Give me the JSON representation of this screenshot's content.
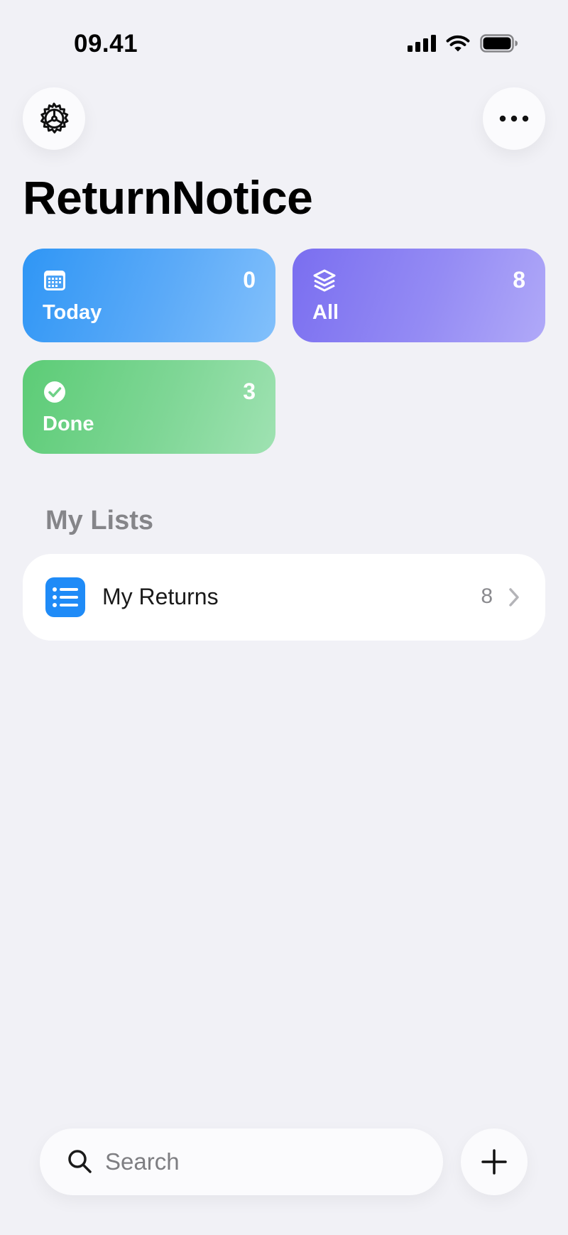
{
  "status_bar": {
    "time": "09.41",
    "icons": [
      "cellular-signal-icon",
      "wifi-icon",
      "battery-icon"
    ]
  },
  "header": {
    "settings_icon": "gear-icon",
    "more_icon": "ellipsis-icon",
    "title": "ReturnNotice"
  },
  "smart_lists": [
    {
      "label": "Today",
      "count": "0",
      "icon": "calendar-icon",
      "color_from": "#2f96f5",
      "color_to": "#82c0fb"
    },
    {
      "label": "All",
      "count": "8",
      "icon": "stack-icon",
      "color_from": "#7a6ef0",
      "color_to": "#b0a9f8"
    },
    {
      "label": "Done",
      "count": "3",
      "icon": "checkmark-circle-icon",
      "color_from": "#5ccc76",
      "color_to": "#9fe2b2"
    }
  ],
  "my_lists": {
    "title": "My Lists",
    "items": [
      {
        "name": "My Returns",
        "count": "8",
        "icon": "list-bullet-icon",
        "icon_color": "#1f8bf7"
      }
    ]
  },
  "bottom_bar": {
    "search_placeholder": "Search",
    "search_value": "",
    "search_icon": "search-icon",
    "add_icon": "plus-icon"
  },
  "colors": {
    "background": "#f1f1f6",
    "surface": "#fbfbfd",
    "secondary_text": "#858589"
  }
}
